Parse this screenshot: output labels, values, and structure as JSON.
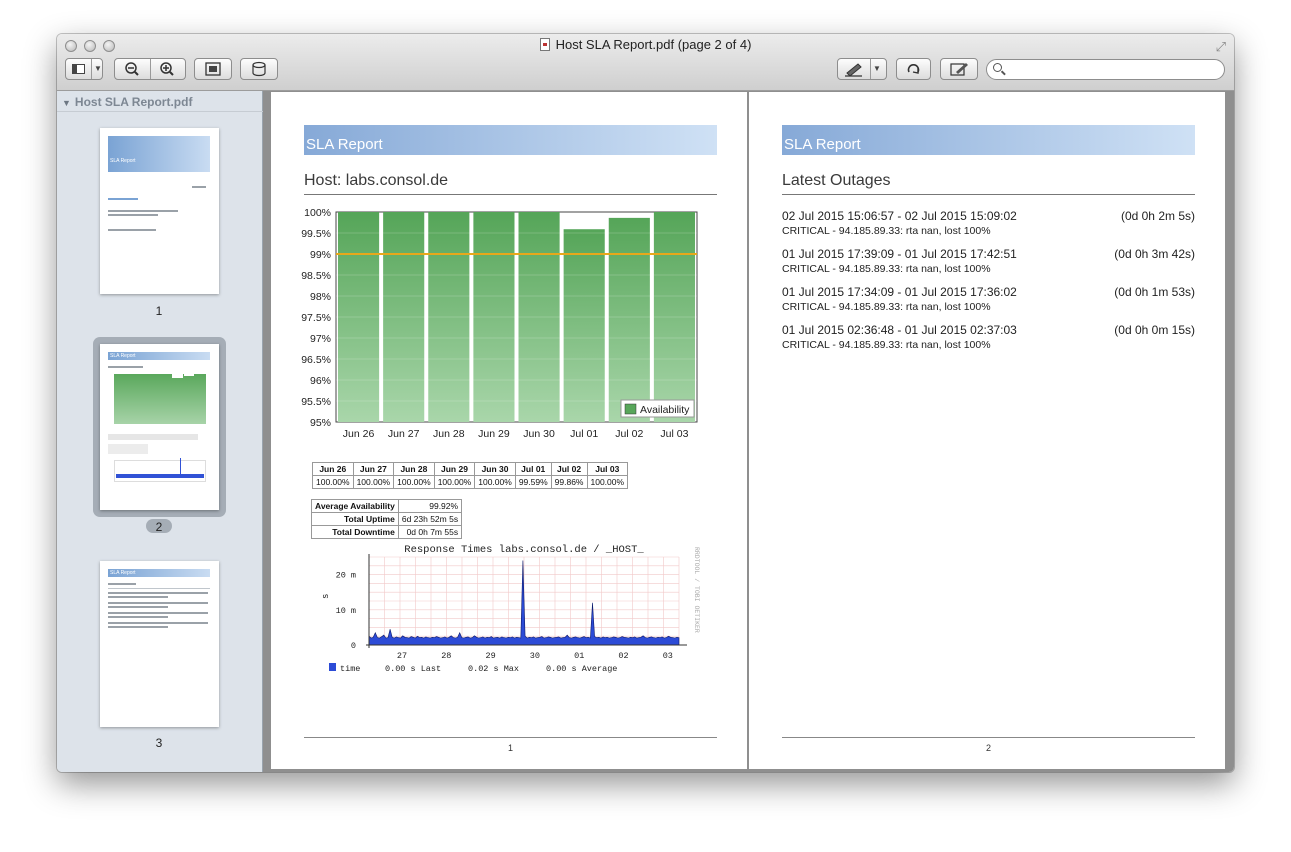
{
  "window": {
    "title": "Host SLA Report.pdf (page 2 of 4)",
    "search_placeholder": ""
  },
  "toolbar": {
    "sidebar_toggle_icon": "sidebar-icon",
    "zoom_out_icon": "zoom-out-icon",
    "zoom_in_icon": "zoom-in-icon",
    "fit_icon": "fit-page-icon",
    "share_icon": "share-icon",
    "highlight_icon": "highlighter-icon",
    "rotate_icon": "rotate-icon",
    "annotate_icon": "annotate-icon"
  },
  "sidebar": {
    "header": "Host SLA Report.pdf",
    "thumbnails": [
      {
        "label": "1",
        "band_text": "SLA Report"
      },
      {
        "label": "2",
        "band_text": "SLA Report"
      },
      {
        "label": "3",
        "band_text": "SLA Report"
      }
    ]
  },
  "page1": {
    "band_title": "SLA Report",
    "heading": "Host: labs.consol.de",
    "footer": "1",
    "availability_table": {
      "headers": [
        "Jun 26",
        "Jun 27",
        "Jun 28",
        "Jun 29",
        "Jun 30",
        "Jul 01",
        "Jul 02",
        "Jul 03"
      ],
      "values": [
        "100.00%",
        "100.00%",
        "100.00%",
        "100.00%",
        "100.00%",
        "99.59%",
        "99.86%",
        "100.00%"
      ]
    },
    "summary_table": [
      {
        "label": "Average Availability",
        "value": "99.92%"
      },
      {
        "label": "Total Uptime",
        "value": "6d 23h 52m 5s"
      },
      {
        "label": "Total Downtime",
        "value": "0d 0h 7m 55s"
      }
    ]
  },
  "page2": {
    "band_title": "SLA Report",
    "heading": "Latest Outages",
    "footer": "2",
    "outages": [
      {
        "range": "02 Jul 2015 15:06:57 - 02 Jul 2015 15:09:02",
        "duration": "(0d 0h 2m 5s)",
        "message": "CRITICAL - 94.185.89.33: rta nan, lost 100%"
      },
      {
        "range": "01 Jul 2015 17:39:09 - 01 Jul 2015 17:42:51",
        "duration": "(0d 0h 3m 42s)",
        "message": "CRITICAL - 94.185.89.33: rta nan, lost 100%"
      },
      {
        "range": "01 Jul 2015 17:34:09 - 01 Jul 2015 17:36:02",
        "duration": "(0d 0h 1m 53s)",
        "message": "CRITICAL - 94.185.89.33: rta nan, lost 100%"
      },
      {
        "range": "01 Jul 2015 02:36:48 - 01 Jul 2015 02:37:03",
        "duration": "(0d 0h 0m 15s)",
        "message": "CRITICAL - 94.185.89.33: rta nan, lost 100%"
      }
    ]
  },
  "chart_data": [
    {
      "type": "bar",
      "categories": [
        "Jun 26",
        "Jun 27",
        "Jun 28",
        "Jun 29",
        "Jun 30",
        "Jul 01",
        "Jul 02",
        "Jul 03"
      ],
      "values": [
        100,
        100,
        100,
        100,
        100,
        99.59,
        99.86,
        100
      ],
      "series": [
        {
          "name": "Availability",
          "values": [
            100,
            100,
            100,
            100,
            100,
            99.59,
            99.86,
            100
          ]
        }
      ],
      "yticks": [
        "100%",
        "99.5%",
        "99%",
        "98.5%",
        "98%",
        "97.5%",
        "97%",
        "96.5%",
        "96%",
        "95.5%",
        "95%"
      ],
      "ylim": [
        95,
        100
      ],
      "threshold": 99,
      "legend": "bottom-right",
      "grid": true,
      "colors": {
        "bar": "#58a65a",
        "threshold": "#e7a81a"
      }
    },
    {
      "type": "area",
      "title": "Response Times labs.consol.de / _HOST_",
      "ylabel": "s",
      "side_label": "RRDTOOL / TOBI OETIKER",
      "xticks": [
        "27",
        "28",
        "29",
        "30",
        "01",
        "02",
        "03"
      ],
      "yticks": [
        "20 m",
        "10 m",
        "0"
      ],
      "ylim": [
        0,
        0.025
      ],
      "series": [
        {
          "name": "time",
          "values": [
            0.0025,
            0.002,
            0.0022,
            0.0035,
            0.0021,
            0.002,
            0.0024,
            0.0028,
            0.002,
            0.0021,
            0.0045,
            0.0022,
            0.002,
            0.0023,
            0.0021,
            0.002,
            0.0026,
            0.0022,
            0.0021,
            0.002,
            0.0024,
            0.0022,
            0.002,
            0.0025,
            0.0021,
            0.0022,
            0.002,
            0.0023,
            0.0021,
            0.002,
            0.0022,
            0.0021,
            0.0024,
            0.0022,
            0.002,
            0.0021,
            0.0023,
            0.002,
            0.0022,
            0.0026,
            0.0021,
            0.002,
            0.0022,
            0.0035,
            0.0021,
            0.002,
            0.0022,
            0.0023,
            0.002,
            0.0021,
            0.0026,
            0.0022,
            0.002,
            0.0021,
            0.0023,
            0.002,
            0.0022,
            0.0021,
            0.0024,
            0.002,
            0.0021,
            0.0022,
            0.002,
            0.0023,
            0.0021,
            0.002,
            0.0022,
            0.0021,
            0.0023,
            0.002,
            0.0022,
            0.0021,
            0.002,
            0.024,
            0.0025,
            0.002,
            0.0022,
            0.0021,
            0.0023,
            0.002,
            0.0021,
            0.0022,
            0.0024,
            0.002,
            0.0021,
            0.0023,
            0.0022,
            0.002,
            0.0021,
            0.0022,
            0.0023,
            0.002,
            0.0021,
            0.0022,
            0.0028,
            0.0021,
            0.002,
            0.0022,
            0.0023,
            0.0021,
            0.002,
            0.0022,
            0.0024,
            0.0021,
            0.0022,
            0.002,
            0.012,
            0.0024,
            0.0021,
            0.0022,
            0.002,
            0.0023,
            0.0021,
            0.0022,
            0.002,
            0.0021,
            0.0023,
            0.0022,
            0.002,
            0.0021,
            0.0024,
            0.0022,
            0.0021,
            0.002,
            0.0022,
            0.0021,
            0.0023,
            0.002,
            0.0021,
            0.0022,
            0.0026,
            0.0021,
            0.002,
            0.0022,
            0.0023,
            0.0021,
            0.002,
            0.0022,
            0.0021,
            0.0023,
            0.002,
            0.0021,
            0.0025,
            0.0022,
            0.0021,
            0.002,
            0.0022,
            0.0021
          ]
        }
      ],
      "legend": [
        {
          "name": "time",
          "text": "0.00 s Last"
        },
        {
          "text": "0.02 s Max"
        },
        {
          "text": "0.00 s Average"
        }
      ],
      "colors": {
        "area": "#2c4bd6",
        "line": "#0c1a6b",
        "grid": "#f2c9c9"
      }
    }
  ]
}
